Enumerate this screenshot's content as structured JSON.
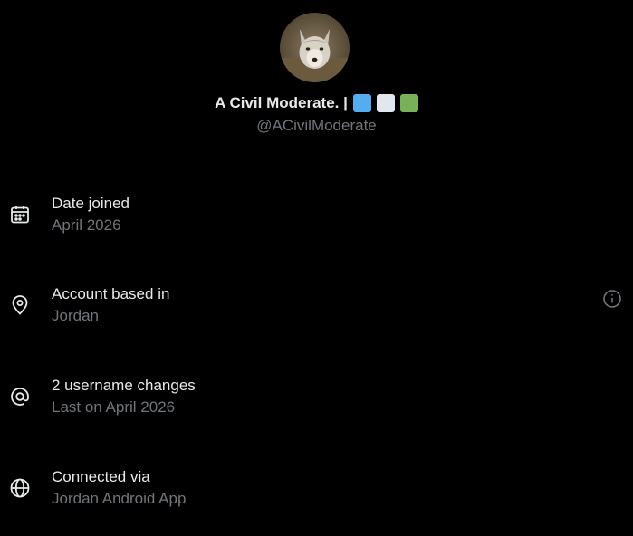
{
  "profile": {
    "display_name": "A Civil Moderate. |",
    "handle": "@ACivilModerate",
    "avatar_icon": "wolf-avatar",
    "flag_squares": [
      "#55acee",
      "#e1e8ed",
      "#78b159"
    ]
  },
  "details": [
    {
      "icon": "calendar-icon",
      "title": "Date joined",
      "value": "April 2026"
    },
    {
      "icon": "location-pin-icon",
      "title": "Account based in",
      "value": "Jordan",
      "trailing_icon": "info-icon"
    },
    {
      "icon": "at-sign-icon",
      "title": "2 username changes",
      "value": "Last on April 2026"
    },
    {
      "icon": "globe-icon",
      "title": "Connected via",
      "value": "Jordan Android App"
    }
  ],
  "colors": {
    "background": "#000000",
    "primary_text": "#e7e9ea",
    "secondary_text": "#71767b"
  }
}
